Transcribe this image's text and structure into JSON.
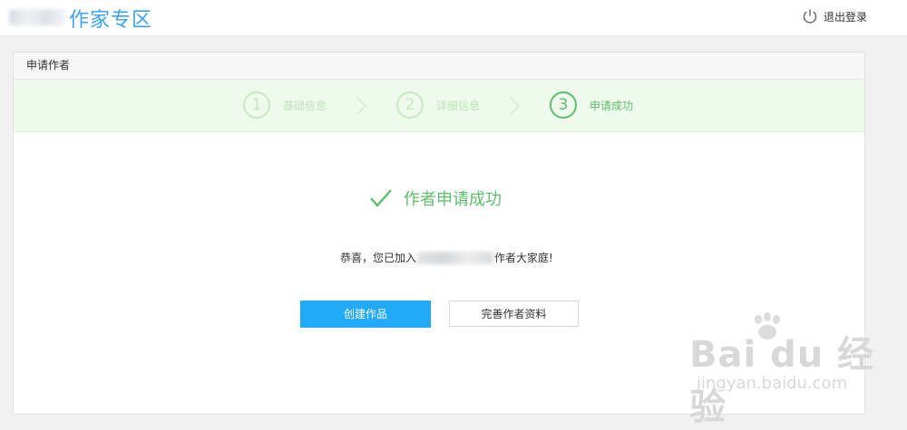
{
  "header": {
    "site_title": "作家专区",
    "logout_label": "退出登录"
  },
  "card": {
    "title": "申请作者",
    "steps": [
      {
        "number": "1",
        "label": "基础信息",
        "active": false
      },
      {
        "number": "2",
        "label": "详细信息",
        "active": false
      },
      {
        "number": "3",
        "label": "申请成功",
        "active": true
      }
    ],
    "success_title": "作者申请成功",
    "congrats_prefix": "恭喜，您已加入",
    "congrats_suffix": "作者大家庭!",
    "buttons": {
      "create_label": "创建作品",
      "complete_label": "完善作者资料"
    }
  },
  "watermark": {
    "brand": "Bai du 经验",
    "url": "jingyan.baidu.com"
  },
  "colors": {
    "accent_blue": "#22aaf8",
    "success_green": "#5cbf6a",
    "steps_bg": "#eefaec",
    "title_blue": "#3ea3f5"
  },
  "icons": {
    "logout": "power-icon",
    "success": "check-icon",
    "step_separator": "chevron-right-icon"
  }
}
